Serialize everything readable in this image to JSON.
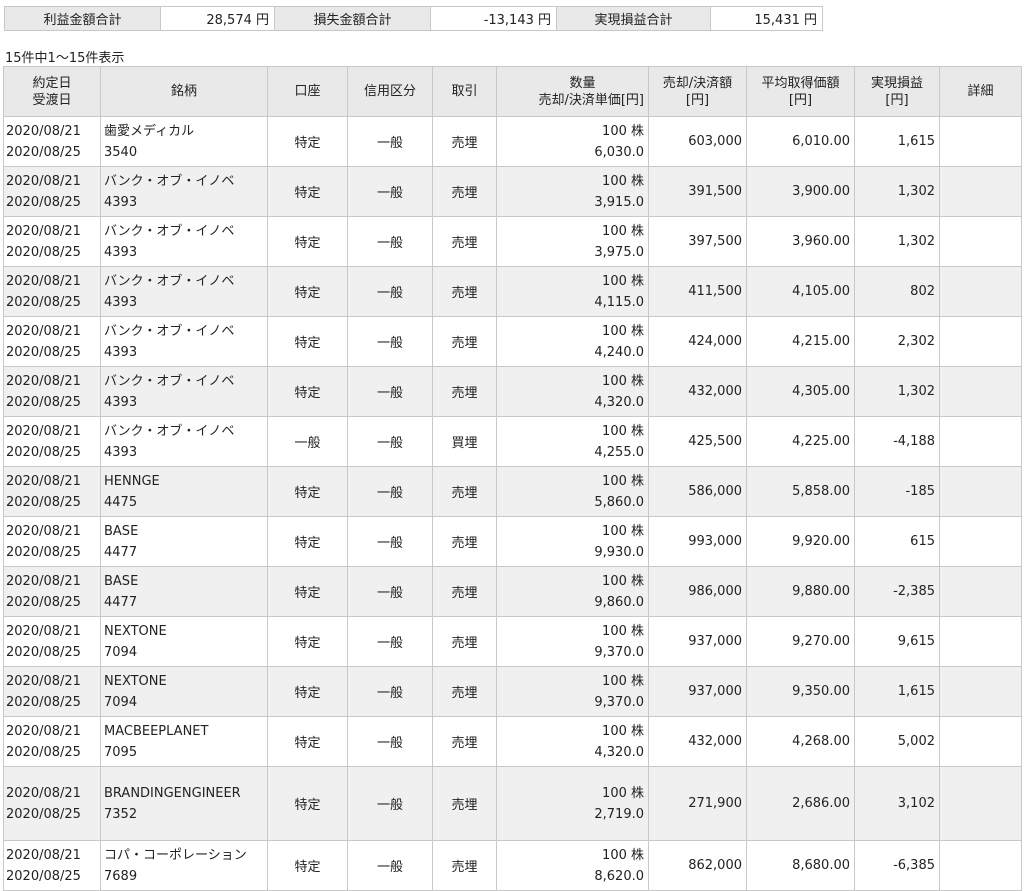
{
  "summary": {
    "profit_label": "利益金額合計",
    "profit_value": "28,574 円",
    "loss_label": "損失金額合計",
    "loss_value": "-13,143 円",
    "total_label": "実現損益合計",
    "total_value": "15,431 円"
  },
  "count_text": "15件中1～15件表示",
  "headers": {
    "date_line1": "約定日",
    "date_line2": "受渡日",
    "name": "銘柄",
    "account": "口座",
    "credit": "信用区分",
    "trade": "取引",
    "qty_line1": "数量",
    "qty_line2": "売却/決済単価[円]",
    "amount_line1": "売却/決済額",
    "amount_line2": "[円]",
    "avg_line1": "平均取得価額",
    "avg_line2": "[円]",
    "pl_line1": "実現損益",
    "pl_line2": "[円]",
    "detail": "詳細"
  },
  "rows": [
    {
      "trade_date": "2020/08/21",
      "settle_date": "2020/08/25",
      "name": "歯愛メディカル",
      "code": "3540",
      "account": "特定",
      "credit": "一般",
      "type": "売埋",
      "qty": "100 株",
      "price": "6,030.0",
      "amount": "603,000",
      "avg": "6,010.00",
      "pl": "1,615"
    },
    {
      "trade_date": "2020/08/21",
      "settle_date": "2020/08/25",
      "name": "バンク・オブ・イノベ",
      "code": "4393",
      "account": "特定",
      "credit": "一般",
      "type": "売埋",
      "qty": "100 株",
      "price": "3,915.0",
      "amount": "391,500",
      "avg": "3,900.00",
      "pl": "1,302"
    },
    {
      "trade_date": "2020/08/21",
      "settle_date": "2020/08/25",
      "name": "バンク・オブ・イノベ",
      "code": "4393",
      "account": "特定",
      "credit": "一般",
      "type": "売埋",
      "qty": "100 株",
      "price": "3,975.0",
      "amount": "397,500",
      "avg": "3,960.00",
      "pl": "1,302"
    },
    {
      "trade_date": "2020/08/21",
      "settle_date": "2020/08/25",
      "name": "バンク・オブ・イノベ",
      "code": "4393",
      "account": "特定",
      "credit": "一般",
      "type": "売埋",
      "qty": "100 株",
      "price": "4,115.0",
      "amount": "411,500",
      "avg": "4,105.00",
      "pl": "802"
    },
    {
      "trade_date": "2020/08/21",
      "settle_date": "2020/08/25",
      "name": "バンク・オブ・イノベ",
      "code": "4393",
      "account": "特定",
      "credit": "一般",
      "type": "売埋",
      "qty": "100 株",
      "price": "4,240.0",
      "amount": "424,000",
      "avg": "4,215.00",
      "pl": "2,302"
    },
    {
      "trade_date": "2020/08/21",
      "settle_date": "2020/08/25",
      "name": "バンク・オブ・イノベ",
      "code": "4393",
      "account": "特定",
      "credit": "一般",
      "type": "売埋",
      "qty": "100 株",
      "price": "4,320.0",
      "amount": "432,000",
      "avg": "4,305.00",
      "pl": "1,302"
    },
    {
      "trade_date": "2020/08/21",
      "settle_date": "2020/08/25",
      "name": "バンク・オブ・イノベ",
      "code": "4393",
      "account": "一般",
      "credit": "一般",
      "type": "買埋",
      "qty": "100 株",
      "price": "4,255.0",
      "amount": "425,500",
      "avg": "4,225.00",
      "pl": "-4,188"
    },
    {
      "trade_date": "2020/08/21",
      "settle_date": "2020/08/25",
      "name": "HENNGE",
      "code": "4475",
      "account": "特定",
      "credit": "一般",
      "type": "売埋",
      "qty": "100 株",
      "price": "5,860.0",
      "amount": "586,000",
      "avg": "5,858.00",
      "pl": "-185"
    },
    {
      "trade_date": "2020/08/21",
      "settle_date": "2020/08/25",
      "name": "BASE",
      "code": "4477",
      "account": "特定",
      "credit": "一般",
      "type": "売埋",
      "qty": "100 株",
      "price": "9,930.0",
      "amount": "993,000",
      "avg": "9,920.00",
      "pl": "615"
    },
    {
      "trade_date": "2020/08/21",
      "settle_date": "2020/08/25",
      "name": "BASE",
      "code": "4477",
      "account": "特定",
      "credit": "一般",
      "type": "売埋",
      "qty": "100 株",
      "price": "9,860.0",
      "amount": "986,000",
      "avg": "9,880.00",
      "pl": "-2,385"
    },
    {
      "trade_date": "2020/08/21",
      "settle_date": "2020/08/25",
      "name": "NEXTONE",
      "code": "7094",
      "account": "特定",
      "credit": "一般",
      "type": "売埋",
      "qty": "100 株",
      "price": "9,370.0",
      "amount": "937,000",
      "avg": "9,270.00",
      "pl": "9,615"
    },
    {
      "trade_date": "2020/08/21",
      "settle_date": "2020/08/25",
      "name": "NEXTONE",
      "code": "7094",
      "account": "特定",
      "credit": "一般",
      "type": "売埋",
      "qty": "100 株",
      "price": "9,370.0",
      "amount": "937,000",
      "avg": "9,350.00",
      "pl": "1,615"
    },
    {
      "trade_date": "2020/08/21",
      "settle_date": "2020/08/25",
      "name": "MACBEEPLANET",
      "code": "7095",
      "account": "特定",
      "credit": "一般",
      "type": "売埋",
      "qty": "100 株",
      "price": "4,320.0",
      "amount": "432,000",
      "avg": "4,268.00",
      "pl": "5,002"
    },
    {
      "trade_date": "2020/08/21",
      "settle_date": "2020/08/25",
      "name": "BRANDINGENGINEER",
      "code": "7352",
      "account": "特定",
      "credit": "一般",
      "type": "売埋",
      "qty": "100 株",
      "price": "2,719.0",
      "amount": "271,900",
      "avg": "2,686.00",
      "pl": "3,102"
    },
    {
      "trade_date": "2020/08/21",
      "settle_date": "2020/08/25",
      "name": "コパ・コーポレーション",
      "code": "7689",
      "account": "特定",
      "credit": "一般",
      "type": "売埋",
      "qty": "100 株",
      "price": "8,620.0",
      "amount": "862,000",
      "avg": "8,680.00",
      "pl": "-6,385"
    }
  ]
}
